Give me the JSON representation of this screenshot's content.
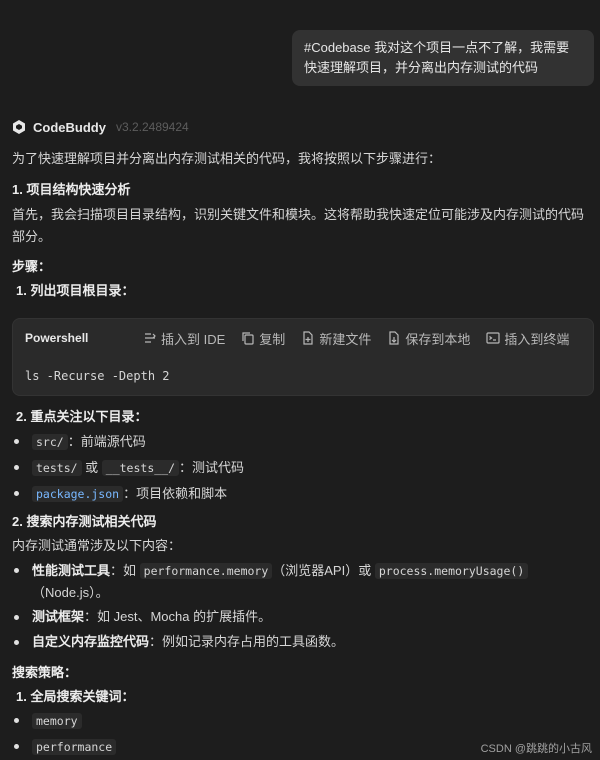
{
  "user_message": "#Codebase 我对这个项目一点不了解，我需要快速理解项目，并分离出内存测试的代码",
  "assistant": {
    "name": "CodeBuddy",
    "version": "v3.2.2489424"
  },
  "intro": "为了快速理解项目并分离出内存测试相关的代码，我将按照以下步骤进行：",
  "section1": {
    "title": "1. 项目结构快速分析",
    "desc": "首先，我会扫描项目目录结构，识别关键文件和模块。这将帮助我快速定位可能涉及内存测试的代码部分。",
    "steps_label": "步骤：",
    "step1": "1. 列出项目根目录：",
    "code_block": {
      "lang": "Powershell",
      "actions": [
        "插入到 IDE",
        "复制",
        "新建文件",
        "保存到本地",
        "插入到终端"
      ],
      "code": "ls -Recurse -Depth 2"
    },
    "step2": "2. 重点关注以下目录：",
    "dirs": [
      {
        "code": "src/",
        "text": "：前端源代码"
      },
      {
        "code": "tests/",
        "mid": " 或 ",
        "code2": "__tests__/",
        "text": "：测试代码"
      },
      {
        "code": "package.json",
        "text": "：项目依赖和脚本"
      }
    ]
  },
  "section2": {
    "title": "2. 搜索内存测试相关代码",
    "desc": "内存测试通常涉及以下内容：",
    "items": [
      {
        "bold": "性能测试工具",
        "a": "：如 ",
        "code1": "performance.memory",
        "b": "（浏览器API）或 ",
        "code2": "process.memoryUsage()",
        "c": "（Node.js）。"
      },
      {
        "bold": "测试框架",
        "a": "：如 Jest、Mocha 的扩展插件。"
      },
      {
        "bold": "自定义内存监控代码",
        "a": "：例如记录内存占用的工具函数。"
      }
    ],
    "strategy_label": "搜索策略：",
    "strategy_step1": "1. 全局搜索关键词：",
    "keywords": [
      "memory",
      "performance"
    ]
  },
  "footer": "CSDN @跳跳的小古风"
}
